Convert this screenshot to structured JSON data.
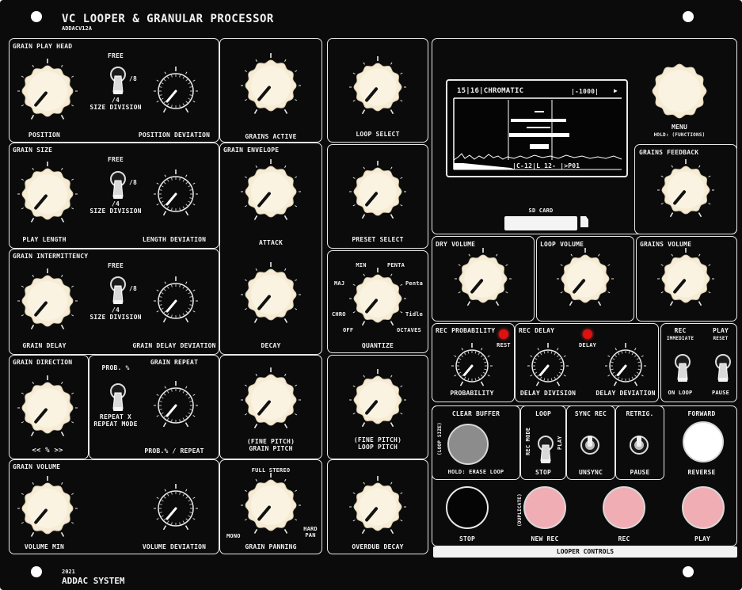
{
  "panel": {
    "title": "VC LOOPER & GRANULAR PROCESSOR",
    "model": "ADDACV12A",
    "year": "2021",
    "maker": "ADDAC SYSTEM"
  },
  "sections": {
    "grain_play_head": "GRAIN PLAY HEAD",
    "grain_size": "GRAIN SIZE",
    "grain_intermittency": "GRAIN INTERMITTENCY",
    "grain_direction": "GRAIN DIRECTION",
    "grain_volume": "GRAIN VOLUME",
    "grain_envelope": "GRAIN ENVELOPE",
    "grains_feedback": "GRAINS FEEDBACK",
    "dry_volume": "DRY VOLUME",
    "loop_volume": "LOOP VOLUME",
    "grains_volume": "GRAINS VOLUME",
    "rec_probability": "REC PROBABILITY",
    "rec_delay": "REC DELAY"
  },
  "labels": {
    "position": "POSITION",
    "position_deviation": "POSITION DEVIATION",
    "play_length": "PLAY LENGTH",
    "length_deviation": "LENGTH DEVIATION",
    "grain_delay": "GRAIN DELAY",
    "grain_delay_deviation": "GRAIN DELAY DEVIATION",
    "direction_scale": "<<  %  >>",
    "prob_pct": "PROB. %",
    "grain_repeat": "GRAIN REPEAT",
    "repeat_x": "REPEAT X",
    "repeat_mode": "REPEAT MODE",
    "prob_repeat": "PROB.% / REPEAT",
    "volume_min": "VOLUME MIN",
    "volume_deviation": "VOLUME DEVIATION",
    "grains_active": "GRAINS ACTIVE",
    "attack": "ATTACK",
    "decay": "DECAY",
    "fine_pitch": "(FINE PITCH)",
    "grain_pitch": "GRAIN PITCH",
    "full_stereo": "FULL STEREO",
    "mono": "MONO",
    "hard": "HARD",
    "pan": "PAN",
    "grain_panning": "GRAIN PANNING",
    "loop_select": "LOOP SELECT",
    "preset_select": "PRESET SELECT",
    "quantize": "QUANTIZE",
    "loop_pitch": "LOOP PITCH",
    "overdub_decay": "OVERDUB DECAY",
    "menu": "MENU",
    "hold_functions": "HOLD: (FUNCTIONS)",
    "sd_card": "SD CARD",
    "probability": "PROBABILITY",
    "rest": "REST",
    "delay": "DELAY",
    "delay_division": "DELAY DIVISION",
    "delay_deviation": "DELAY DEVIATION",
    "rec": "REC",
    "immediate": "IMMEDIATE",
    "on_loop": "ON LOOP",
    "play": "PLAY",
    "reset": "RESET",
    "pause": "PAUSE",
    "clear_buffer": "CLEAR BUFFER",
    "loop_size": "(LOOP SIZE)",
    "hold_erase_loop": "HOLD: ERASE LOOP",
    "loop": "LOOP",
    "rec_mode": "REC MODE",
    "stop": "STOP",
    "sync_rec": "SYNC REC",
    "unsync": "UNSYNC",
    "retrig": "RETRIG.",
    "forward": "FORWARD",
    "reverse": "REVERSE",
    "duplicate": "(DUPLICATE)",
    "new_rec": "NEW REC",
    "looper_controls": "LOOPER CONTROLS"
  },
  "size_division": {
    "free": "FREE",
    "div8": "/8",
    "div4": "/4",
    "label": "SIZE DIVISION"
  },
  "quantize_modes": {
    "min": "MIN",
    "penta": "PENTA",
    "maj": "MAJ",
    "penta2": "Penta",
    "chro": "CHRO",
    "tidle": "Tidle",
    "off": "OFF",
    "octaves": "OCTAVES"
  },
  "display": {
    "header": "15|16|CHROMATIC",
    "value": "|-1000|",
    "arrow": "▶",
    "footer": "|C-12|L 12-  |>P01"
  },
  "colors": {
    "panel": "#0b0b0b",
    "knob": "#f6ecd6",
    "led": "#e01010",
    "button_grey": "#8c8c8c",
    "button_black": "#050505",
    "button_white": "#ffffff",
    "button_pink": "#f0aeb4"
  },
  "icons": {
    "sd": "sd-card-icon",
    "hole": "mounting-hole-icon"
  }
}
